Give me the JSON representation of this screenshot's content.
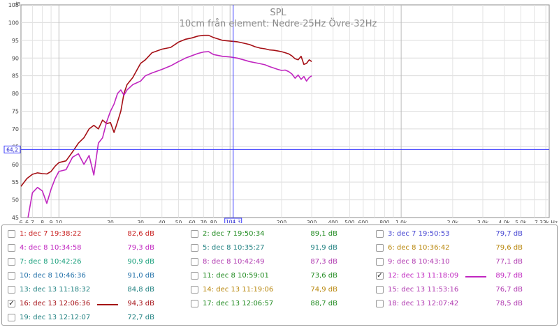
{
  "chart_data": {
    "type": "line",
    "title": "SPL",
    "subtitle": "10cm från element: Nedre-25Hz Övre-32Hz",
    "ylabel": "dB",
    "xlabel": "Hz",
    "xscale": "log",
    "xlim": [
      6,
      7330
    ],
    "ylim": [
      45,
      105
    ],
    "grid": true,
    "x_tick_labels": [
      "6",
      "6",
      "7",
      "8",
      "9",
      "10",
      "20",
      "30",
      "40",
      "50",
      "60",
      "70",
      "80",
      "100",
      "200",
      "300",
      "400",
      "500",
      "600",
      "800",
      "1,0k",
      "2,0k",
      "3,0k",
      "4,0k",
      "5,0k",
      "7,33k Hz"
    ],
    "y_tick_labels": [
      "45",
      "50",
      "55",
      "60",
      "65",
      "70",
      "75",
      "80",
      "85",
      "90",
      "95",
      "100",
      "105"
    ],
    "cursor": {
      "x": 104.3,
      "y": 64.2,
      "x_label": "104,3",
      "y_label": "64,2"
    },
    "series": [
      {
        "name": "16: dec 13 12:06:36",
        "color": "#a50f15",
        "x": [
          6,
          6.5,
          7,
          7.5,
          8,
          8.5,
          9,
          9.5,
          10,
          11,
          12,
          13,
          14,
          15,
          16,
          17,
          18,
          19,
          20,
          21,
          22,
          23,
          24,
          25,
          27,
          30,
          32,
          35,
          40,
          45,
          50,
          55,
          60,
          65,
          70,
          75,
          80,
          90,
          100,
          110,
          120,
          130,
          140,
          150,
          160,
          170,
          180,
          190,
          200,
          210,
          220,
          230,
          240,
          250,
          260,
          270,
          280,
          290,
          300
        ],
        "y": [
          53.8,
          56,
          57.2,
          57.6,
          57.4,
          57.3,
          58,
          59.5,
          60.5,
          61,
          63.5,
          66,
          67.5,
          70,
          71,
          70,
          72.5,
          71.5,
          71.8,
          69,
          72,
          75,
          80,
          82.5,
          84.5,
          88.5,
          89.5,
          91.5,
          92.5,
          93,
          94.5,
          95.3,
          95.7,
          96.2,
          96.4,
          96.4,
          95.8,
          95,
          94.8,
          94.6,
          94.2,
          93.8,
          93.2,
          92.8,
          92.6,
          92.3,
          92.2,
          92.0,
          91.8,
          91.5,
          91.2,
          90.6,
          89.8,
          89.5,
          90.5,
          88.2,
          88.5,
          89.5,
          89.0
        ]
      },
      {
        "name": "12: dec 13 11:18:09",
        "color": "#c026c0",
        "x": [
          6.6,
          7,
          7.5,
          8,
          8.5,
          9,
          9.5,
          10,
          11,
          12,
          13,
          14,
          15,
          16,
          17,
          18,
          19,
          20,
          21,
          22,
          23,
          24,
          25,
          27,
          30,
          32,
          35,
          40,
          45,
          50,
          55,
          60,
          65,
          70,
          75,
          80,
          90,
          100,
          110,
          120,
          130,
          140,
          150,
          160,
          170,
          180,
          190,
          200,
          210,
          220,
          230,
          240,
          250,
          260,
          270,
          280,
          290,
          300
        ],
        "y": [
          45,
          52,
          53.5,
          52.5,
          49,
          53,
          56,
          58,
          58.5,
          62,
          63,
          60,
          62.5,
          57,
          66,
          67.5,
          72,
          75,
          77,
          80,
          81,
          79.5,
          81,
          82.5,
          83.5,
          85,
          85.8,
          86.8,
          87.8,
          89,
          90,
          90.7,
          91.3,
          91.7,
          91.8,
          91,
          90.5,
          90.3,
          90,
          89.5,
          89,
          88.7,
          88.4,
          88.1,
          87.6,
          87.2,
          86.8,
          86.5,
          86.6,
          86.2,
          85.5,
          84.3,
          85.2,
          84.0,
          84.8,
          83.5,
          84.5,
          85.0
        ]
      }
    ]
  },
  "legend": {
    "items": [
      {
        "id": 1,
        "label": "1: dec 7 19:38:22",
        "value": "82,6 dB",
        "color": "#c81e1e",
        "checked": false,
        "swatch": false
      },
      {
        "id": 2,
        "label": "2: dec 7 19:50:34",
        "value": "89,1 dB",
        "color": "#1f8a1f",
        "checked": false,
        "swatch": false
      },
      {
        "id": 3,
        "label": "3: dec 7 19:50:53",
        "value": "79,7 dB",
        "color": "#4646d2",
        "checked": false,
        "swatch": false
      },
      {
        "id": 4,
        "label": "4: dec 8 10:34:58",
        "value": "79,3 dB",
        "color": "#c026c0",
        "checked": false,
        "swatch": false
      },
      {
        "id": 5,
        "label": "5: dec 8 10:35:27",
        "value": "91,9 dB",
        "color": "#1f8080",
        "checked": false,
        "swatch": false
      },
      {
        "id": 6,
        "label": "6: dec 8 10:36:42",
        "value": "79,6 dB",
        "color": "#b8860b",
        "checked": false,
        "swatch": false
      },
      {
        "id": 7,
        "label": "7: dec 8 10:42:26",
        "value": "90,9 dB",
        "color": "#169e7a",
        "checked": false,
        "swatch": false
      },
      {
        "id": 8,
        "label": "8: dec 8 10:42:49",
        "value": "87,3 dB",
        "color": "#b03ab0",
        "checked": false,
        "swatch": false
      },
      {
        "id": 9,
        "label": "9: dec 8 10:43:10",
        "value": "77,1 dB",
        "color": "#b03ab0",
        "checked": false,
        "swatch": false
      },
      {
        "id": 10,
        "label": "10: dec 8 10:46:36",
        "value": "91,0 dB",
        "color": "#1f6fa8",
        "checked": false,
        "swatch": false
      },
      {
        "id": 11,
        "label": "11: dec 8 10:59:01",
        "value": "73,6 dB",
        "color": "#1f8a1f",
        "checked": false,
        "swatch": false
      },
      {
        "id": 12,
        "label": "12: dec 13 11:18:09",
        "value": "89,7 dB",
        "color": "#c026c0",
        "checked": true,
        "swatch": true
      },
      {
        "id": 13,
        "label": "13: dec 13 11:18:32",
        "value": "84,8 dB",
        "color": "#1f8080",
        "checked": false,
        "swatch": false
      },
      {
        "id": 14,
        "label": "14: dec 13 11:19:06",
        "value": "74,9 dB",
        "color": "#b8860b",
        "checked": false,
        "swatch": false
      },
      {
        "id": 15,
        "label": "15: dec 13 11:53:16",
        "value": "76,7 dB",
        "color": "#b03ab0",
        "checked": false,
        "swatch": false
      },
      {
        "id": 16,
        "label": "16: dec 13 12:06:36",
        "value": "94,3 dB",
        "color": "#a50f15",
        "checked": true,
        "swatch": true
      },
      {
        "id": 17,
        "label": "17: dec 13 12:06:57",
        "value": "88,7 dB",
        "color": "#1f8a1f",
        "checked": false,
        "swatch": false
      },
      {
        "id": 18,
        "label": "18: dec 13 12:07:42",
        "value": "78,5 dB",
        "color": "#b03ab0",
        "checked": false,
        "swatch": false
      },
      {
        "id": 19,
        "label": "19: dec 13 12:12:07",
        "value": "72,7 dB",
        "color": "#1f8080",
        "checked": false,
        "swatch": false
      }
    ]
  }
}
